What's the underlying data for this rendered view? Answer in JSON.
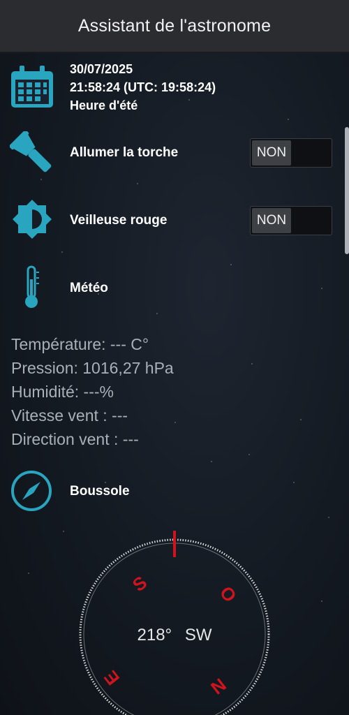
{
  "app": {
    "title": "Assistant de l'astronome"
  },
  "datetime": {
    "date": "30/07/2025",
    "time": "21:58:24 (UTC: 19:58:24)",
    "season": "Heure d'été"
  },
  "torch": {
    "label": "Allumer la torche",
    "state": "NON"
  },
  "red_light": {
    "label": "Veilleuse rouge",
    "state": "NON"
  },
  "weather": {
    "label": "Météo",
    "lines": [
      "Température: --- C°",
      "Pression: 1016,27 hPa",
      "Humidité: ---%",
      "Vitesse vent : ---",
      "Direction vent : ---"
    ]
  },
  "compass": {
    "label": "Boussole",
    "heading_deg": "218°",
    "heading_dir": "SW",
    "cardinals": {
      "S": "S",
      "O": "O",
      "N": "N",
      "E": "E"
    }
  },
  "colors": {
    "accent": "#2aa5c0",
    "compass_red": "#d0141e",
    "bg": "#161c24",
    "titlebar": "#2a2c2f"
  }
}
